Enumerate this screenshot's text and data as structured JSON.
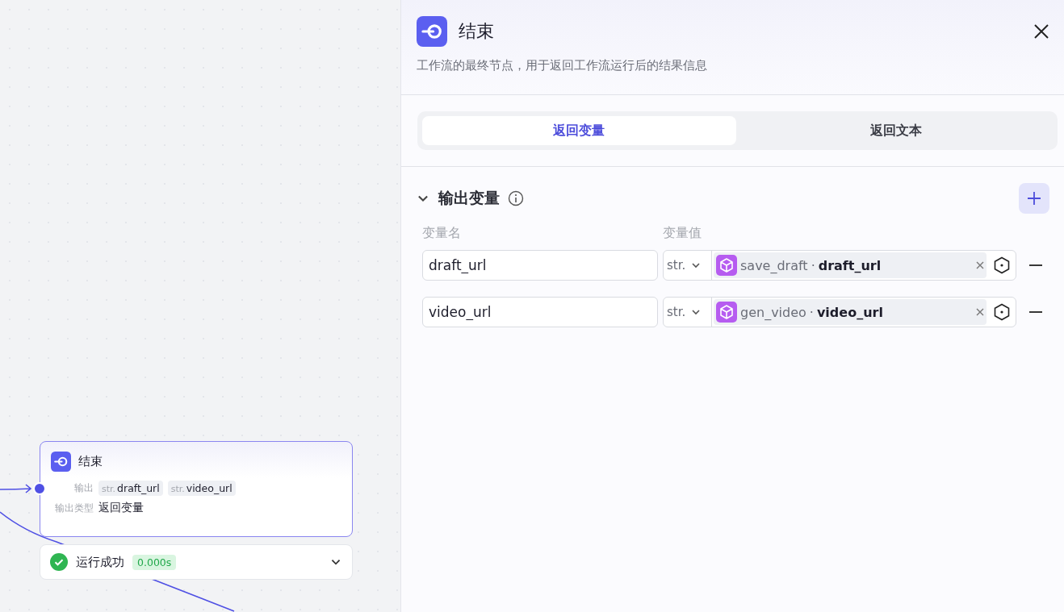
{
  "canvas": {
    "node": {
      "title": "结束",
      "outputs_label": "输出",
      "outputs": [
        {
          "type": "str.",
          "name": "draft_url"
        },
        {
          "type": "str.",
          "name": "video_url"
        }
      ],
      "output_type_label": "输出类型",
      "output_type": "返回变量"
    },
    "run_status": {
      "kind": "success",
      "label": "运行成功",
      "time": "0.000s",
      "expanded": false
    }
  },
  "panel": {
    "title": "结束",
    "description": "工作流的最终节点，用于返回工作流运行后的结果信息",
    "tabs": [
      {
        "label": "返回变量",
        "selected": true
      },
      {
        "label": "返回文本",
        "selected": false
      }
    ],
    "section": {
      "title": "输出变量",
      "expanded": true
    },
    "columns": [
      "变量名",
      "变量值"
    ],
    "variables": [
      {
        "name": "draft_url",
        "type": "str.",
        "source_node": "save_draft",
        "separator": "·",
        "source_var": "draft_url"
      },
      {
        "name": "video_url",
        "type": "str.",
        "source_node": "gen_video",
        "separator": "·",
        "source_var": "video_url"
      }
    ]
  }
}
